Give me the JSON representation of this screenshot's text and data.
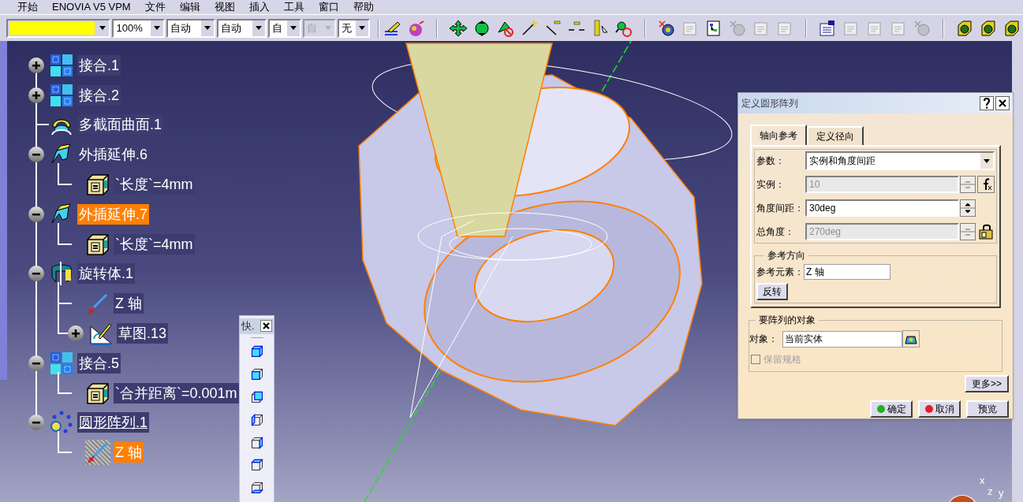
{
  "menu_bar": {
    "items": [
      "开始",
      "ENOVIA V5 VPM",
      "文件",
      "编辑",
      "视图",
      "插入",
      "工具",
      "窗口",
      "帮助"
    ]
  },
  "toolbar": {
    "combos": [
      {
        "kind": "color",
        "color": "#ffff00",
        "disabled": false
      },
      {
        "kind": "text",
        "value": "100%",
        "disabled": false
      },
      {
        "kind": "text",
        "value": "自动",
        "disabled": false
      },
      {
        "kind": "text",
        "value": "自动",
        "disabled": false
      },
      {
        "kind": "text",
        "value": "自",
        "disabled": false
      },
      {
        "kind": "text",
        "value": "自",
        "disabled": true
      },
      {
        "kind": "text",
        "value": "无",
        "disabled": false
      }
    ],
    "icon_groups": [
      [
        {
          "kind": "brush",
          "disabled": false
        },
        {
          "kind": "sphere",
          "disabled": false
        }
      ],
      [
        {
          "kind": "pan",
          "disabled": false
        },
        {
          "kind": "rotate",
          "disabled": false
        },
        {
          "kind": "hide",
          "disabled": false
        },
        {
          "kind": "point",
          "disabled": false
        },
        {
          "kind": "line",
          "disabled": false
        },
        {
          "kind": "arrows",
          "disabled": false
        },
        {
          "kind": "bar",
          "disabled": false
        },
        {
          "kind": "magnifier",
          "disabled": false
        }
      ],
      [
        {
          "kind": "gear",
          "disabled": false
        },
        {
          "kind": "sheet",
          "disabled": true
        },
        {
          "kind": "diagram",
          "disabled": false
        },
        {
          "kind": "gear",
          "disabled": true
        },
        {
          "kind": "sheet",
          "disabled": true
        },
        {
          "kind": "sheet",
          "disabled": true
        }
      ],
      [
        {
          "kind": "list",
          "disabled": false
        },
        {
          "kind": "sheet",
          "disabled": true
        },
        {
          "kind": "sheet",
          "disabled": true
        },
        {
          "kind": "sheet",
          "disabled": true
        },
        {
          "kind": "gear",
          "disabled": true
        }
      ],
      [
        {
          "kind": "cube",
          "disabled": false
        },
        {
          "kind": "cube",
          "disabled": false
        },
        {
          "kind": "cube",
          "disabled": false
        }
      ]
    ]
  },
  "tree": [
    {
      "label": "接合.1",
      "kind": "join",
      "expanded": false,
      "selected": false,
      "current": false
    },
    {
      "label": "接合.2",
      "kind": "join",
      "expanded": false,
      "selected": false,
      "current": false
    },
    {
      "label": "多截面曲面.1",
      "kind": "multisection",
      "selected": false,
      "current": false
    },
    {
      "label": "外插延伸.6",
      "kind": "extrapolate",
      "expanded": true,
      "selected": false,
      "current": false,
      "children": [
        {
          "label": "`长度`=4mm",
          "kind": "parameter",
          "selected": false,
          "current": false
        }
      ]
    },
    {
      "label": "外插延伸.7",
      "kind": "extrapolate",
      "expanded": true,
      "selected": true,
      "current": false,
      "children": [
        {
          "label": "`长度`=4mm",
          "kind": "parameter",
          "selected": false,
          "current": false
        }
      ]
    },
    {
      "label": "旋转体.1",
      "kind": "revolve",
      "expanded": true,
      "selected": false,
      "current": false,
      "children": [
        {
          "label": "Z 轴",
          "kind": "axis",
          "selected": false,
          "current": false
        },
        {
          "label": "草图.13",
          "kind": "sketch",
          "expanded": false,
          "selected": false,
          "current": false
        }
      ]
    },
    {
      "label": "接合.5",
      "kind": "join",
      "expanded": true,
      "selected": false,
      "current": false,
      "children": [
        {
          "label": "`合并距离`=0.001m",
          "kind": "parameter",
          "selected": false,
          "current": false
        }
      ]
    },
    {
      "label": "圆形阵列.1",
      "kind": "pattern",
      "expanded": true,
      "selected": false,
      "current": true,
      "children": [
        {
          "label": "Z 轴",
          "kind": "axis",
          "selected": true,
          "current": false
        }
      ]
    }
  ],
  "float_toolbar": {
    "title": "快.",
    "views": [
      {
        "kind": "iso"
      },
      {
        "kind": "front"
      },
      {
        "kind": "back"
      },
      {
        "kind": "left"
      },
      {
        "kind": "right"
      },
      {
        "kind": "top"
      },
      {
        "kind": "bottom"
      }
    ]
  },
  "compass": {
    "labels": [
      "x",
      "z",
      "y"
    ]
  },
  "dialog": {
    "title": "定义圆形阵列",
    "tabs": [
      {
        "label": "轴向参考",
        "selected": true
      },
      {
        "label": "定义径向",
        "selected": false
      }
    ],
    "fields": [
      {
        "kind": "dropdown",
        "label": "参数：",
        "value": "实例和角度间距",
        "disabled": false
      },
      {
        "kind": "formula",
        "label": "实例：",
        "value": "10",
        "disabled": true
      },
      {
        "kind": "spinner",
        "label": "角度间距：",
        "value": "30deg",
        "disabled": false
      },
      {
        "kind": "locked",
        "label": "总角度：",
        "value": "270deg",
        "disabled": true
      }
    ],
    "reference": {
      "title": "参考方向",
      "label": "参考元素：",
      "value": "Z 轴",
      "button": "反转"
    },
    "objects": {
      "title": "要阵列的对象",
      "label": "对象：",
      "value": "当前实体",
      "checkbox": {
        "label": "保留规格",
        "checked": false,
        "disabled": true
      }
    },
    "more_button": "更多>>",
    "buttons": [
      {
        "kind": "ok",
        "label": "确定"
      },
      {
        "kind": "cancel",
        "label": "取消"
      },
      {
        "kind": "plain",
        "label": "预览"
      }
    ]
  }
}
